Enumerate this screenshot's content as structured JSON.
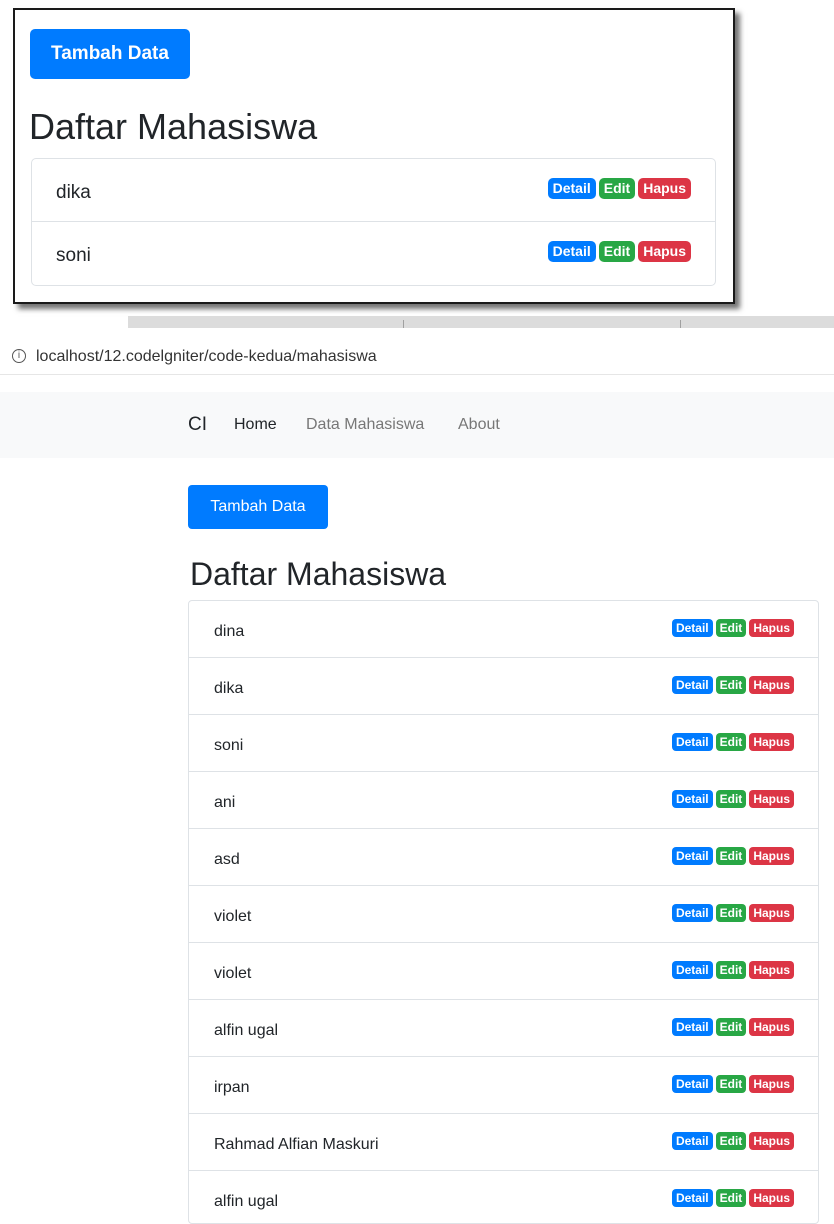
{
  "inset": {
    "add_button": "Tambah Data",
    "title": "Daftar Mahasiswa",
    "students": [
      "dika",
      "soni"
    ]
  },
  "browser": {
    "url": "localhost/12.codelgniter/code-kedua/mahasiswa",
    "info_icon": "info-icon"
  },
  "navbar": {
    "brand": "CI",
    "items": [
      "Home",
      "Data Mahasiswa",
      "About"
    ]
  },
  "main": {
    "add_button": "Tambah Data",
    "title": "Daftar Mahasiswa",
    "students": [
      "dina",
      "dika",
      "soni",
      "ani",
      "asd",
      "violet",
      "violet",
      "alfin ugal",
      "irpan",
      "Rahmad Alfian Maskuri",
      "alfin ugal"
    ]
  },
  "badges": {
    "detail": "Detail",
    "edit": "Edit",
    "hapus": "Hapus"
  },
  "colors": {
    "primary": "#007bff",
    "success": "#28a745",
    "danger": "#dc3545",
    "navbar_bg": "#f8f9fa"
  }
}
